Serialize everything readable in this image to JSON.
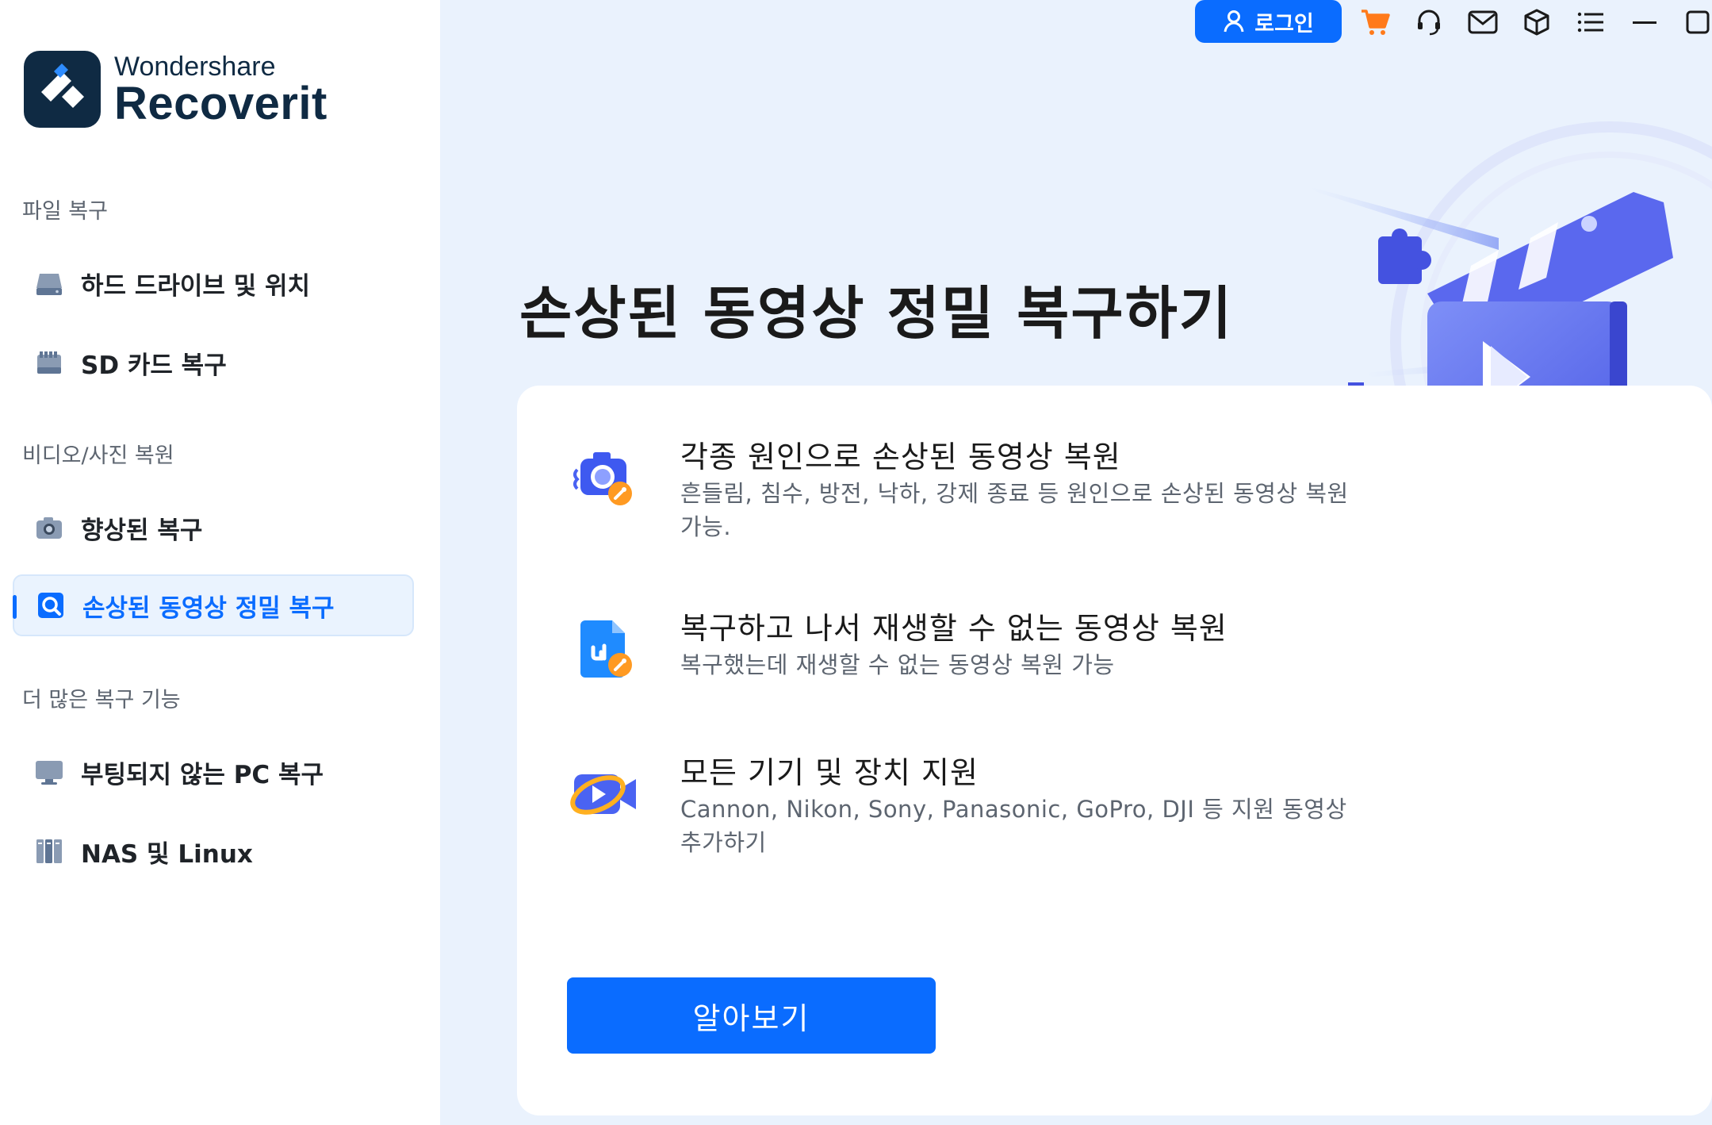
{
  "app": {
    "brand": "Wondershare",
    "product": "Recoverit"
  },
  "sidebar": {
    "sections": [
      {
        "label": "파일 복구"
      },
      {
        "label": "비디오/사진 복원"
      },
      {
        "label": "더 많은 복구 기능"
      }
    ],
    "items": [
      {
        "label": "하드 드라이브 및 위치",
        "icon": "hard-drive-icon"
      },
      {
        "label": "SD 카드 복구",
        "icon": "sd-card-icon"
      },
      {
        "label": "향상된 복구",
        "icon": "camera-icon"
      },
      {
        "label": "손상된 동영상 정밀 복구",
        "icon": "video-repair-icon",
        "active": true
      },
      {
        "label": "부팅되지 않는 PC 복구",
        "icon": "monitor-icon"
      },
      {
        "label": "NAS 및 Linux",
        "icon": "nas-icon"
      }
    ]
  },
  "toolbar": {
    "login_label": "로그인",
    "icons": [
      "cart-icon",
      "headset-icon",
      "mail-icon",
      "box-icon",
      "menu-icon",
      "minimize-icon",
      "maximize-icon"
    ]
  },
  "main": {
    "title": "손상된 동영상 정밀 복구하기",
    "features": [
      {
        "title": "각종 원인으로 손상된 동영상 복원",
        "desc_line1": "흔들림, 침수, 방전, 낙하, 강제 종료 등 원인으로 손상된 동영상 복원",
        "desc_line2": "가능."
      },
      {
        "title": "복구하고 나서 재생할 수 없는 동영상 복원",
        "desc_line1": "복구했는데 재생할 수 없는 동영상 복원 가능",
        "desc_line2": ""
      },
      {
        "title": "모든 기기 및 장치 지원",
        "desc_line1": "Cannon, Nikon, Sony, Panasonic, GoPro, DJI 등 지원 동영상",
        "desc_line2": "추가하기"
      }
    ],
    "cta_label": "알아보기"
  },
  "colors": {
    "accent": "#0a6cff",
    "sidebar_bg": "#ffffff",
    "main_bg": "#eaf2fd",
    "cart": "#ff7a1a"
  }
}
